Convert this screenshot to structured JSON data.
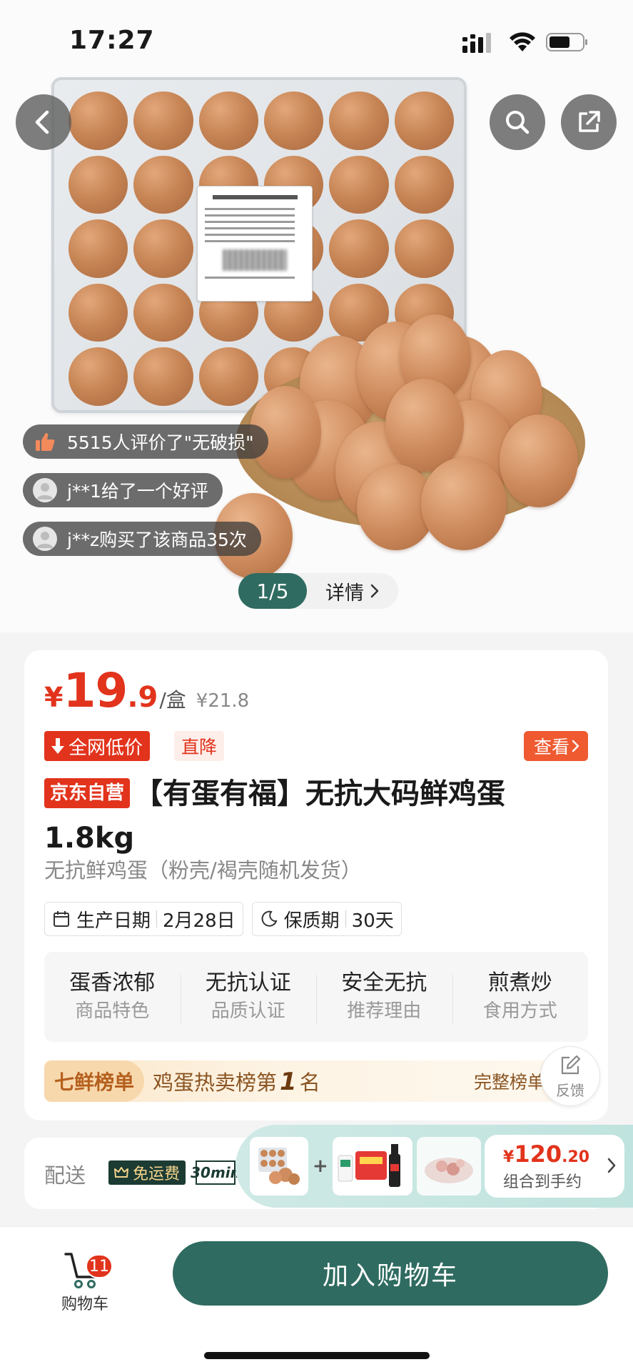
{
  "status_bar": {
    "time": "17:27"
  },
  "hero": {
    "bubbles": [
      {
        "text": "5515人评价了\"无破损\""
      },
      {
        "text": "j**1给了一个好评"
      },
      {
        "text": "j**z购买了该商品35次"
      }
    ],
    "pager": {
      "index": "1/5",
      "detail_label": "详情"
    }
  },
  "price": {
    "currency": "¥",
    "integer": "19",
    "decimal": ".9",
    "unit": "/盒",
    "original": "¥21.8"
  },
  "tags": {
    "lowest": "全网低价",
    "drop": "直降",
    "view": "查看"
  },
  "product": {
    "store_badge": "京东自营",
    "title": "【有蛋有福】无抗大码鲜鸡蛋1.8kg",
    "subtitle": "无抗鲜鸡蛋（粉壳/褐壳随机发货）"
  },
  "meta": {
    "production_label": "生产日期",
    "production_value": "2月28日",
    "shelf_label": "保质期",
    "shelf_value": "30天"
  },
  "features": [
    {
      "value": "蛋香浓郁",
      "key": "商品特色"
    },
    {
      "value": "无抗认证",
      "key": "品质认证"
    },
    {
      "value": "安全无抗",
      "key": "推荐理由"
    },
    {
      "value": "煎煮炒",
      "key": "食用方式"
    }
  ],
  "rank": {
    "badge": "七鲜榜单",
    "prefix": "鸡蛋热卖榜第",
    "rank": "1",
    "suffix": "名",
    "full": "完整榜单"
  },
  "feedback": {
    "label": "反馈"
  },
  "delivery": {
    "label": "配送",
    "free_shipping": "免运费",
    "fast": "30min"
  },
  "combo": {
    "price_yen": "¥",
    "price_int": "120",
    "price_dec": ".20",
    "caption": "组合到手约"
  },
  "bottom": {
    "cart_label": "购物车",
    "cart_count": "11",
    "add_to_cart": "加入购物车"
  },
  "colors": {
    "accent_green": "#2f6b60",
    "price_red": "#e2331c"
  }
}
